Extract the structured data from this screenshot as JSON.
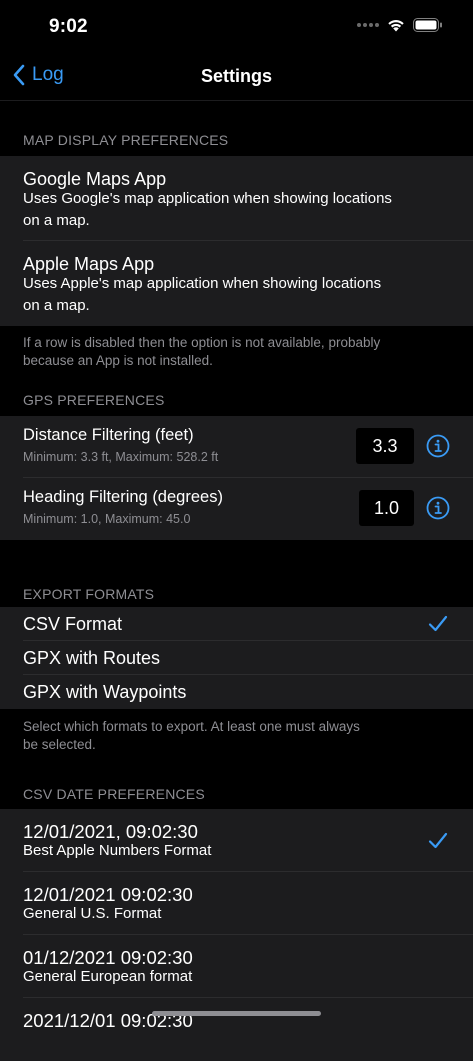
{
  "status": {
    "time": "9:02"
  },
  "nav": {
    "back_label": "Log",
    "title": "Settings"
  },
  "map_display": {
    "header": "MAP DISPLAY PREFERENCES",
    "rows": [
      {
        "title": "Google Maps App",
        "line1": "Uses Google's map application when showing locations",
        "line2": "on a map."
      },
      {
        "title": "Apple Maps App",
        "line1": "Uses Apple's map application when showing locations",
        "line2": "on a map."
      }
    ],
    "footer_line1": "If a row is disabled then the option is not available, probably",
    "footer_line2": "because an App is not installed."
  },
  "gps": {
    "header": "GPS PREFERENCES",
    "rows": [
      {
        "title": "Distance Filtering (feet)",
        "sub": "Minimum: 3.3 ft, Maximum: 528.2 ft",
        "value": "3.3"
      },
      {
        "title": "Heading Filtering (degrees)",
        "sub": "Minimum: 1.0, Maximum: 45.0",
        "value": "1.0"
      }
    ]
  },
  "export": {
    "header": "EXPORT FORMATS",
    "rows": [
      {
        "title": "CSV Format",
        "checked": true
      },
      {
        "title": "GPX with Routes",
        "checked": false
      },
      {
        "title": "GPX with Waypoints",
        "checked": false
      }
    ],
    "footer_line1": "Select which formats to export. At least one must always",
    "footer_line2": "be selected."
  },
  "csv_date": {
    "header": "CSV DATE PREFERENCES",
    "rows": [
      {
        "title": "12/01/2021, 09:02:30",
        "sub": "Best Apple Numbers Format",
        "checked": true
      },
      {
        "title": "12/01/2021 09:02:30",
        "sub": "General U.S. Format",
        "checked": false
      },
      {
        "title": "01/12/2021 09:02:30",
        "sub": "General European format",
        "checked": false
      },
      {
        "title": "2021/12/01 09:02:30",
        "sub": "",
        "checked": false
      }
    ]
  },
  "colors": {
    "accent": "#3a9bf5",
    "background": "#000000",
    "cell": "#1c1c1e",
    "secondary_text": "#8e8e93"
  }
}
